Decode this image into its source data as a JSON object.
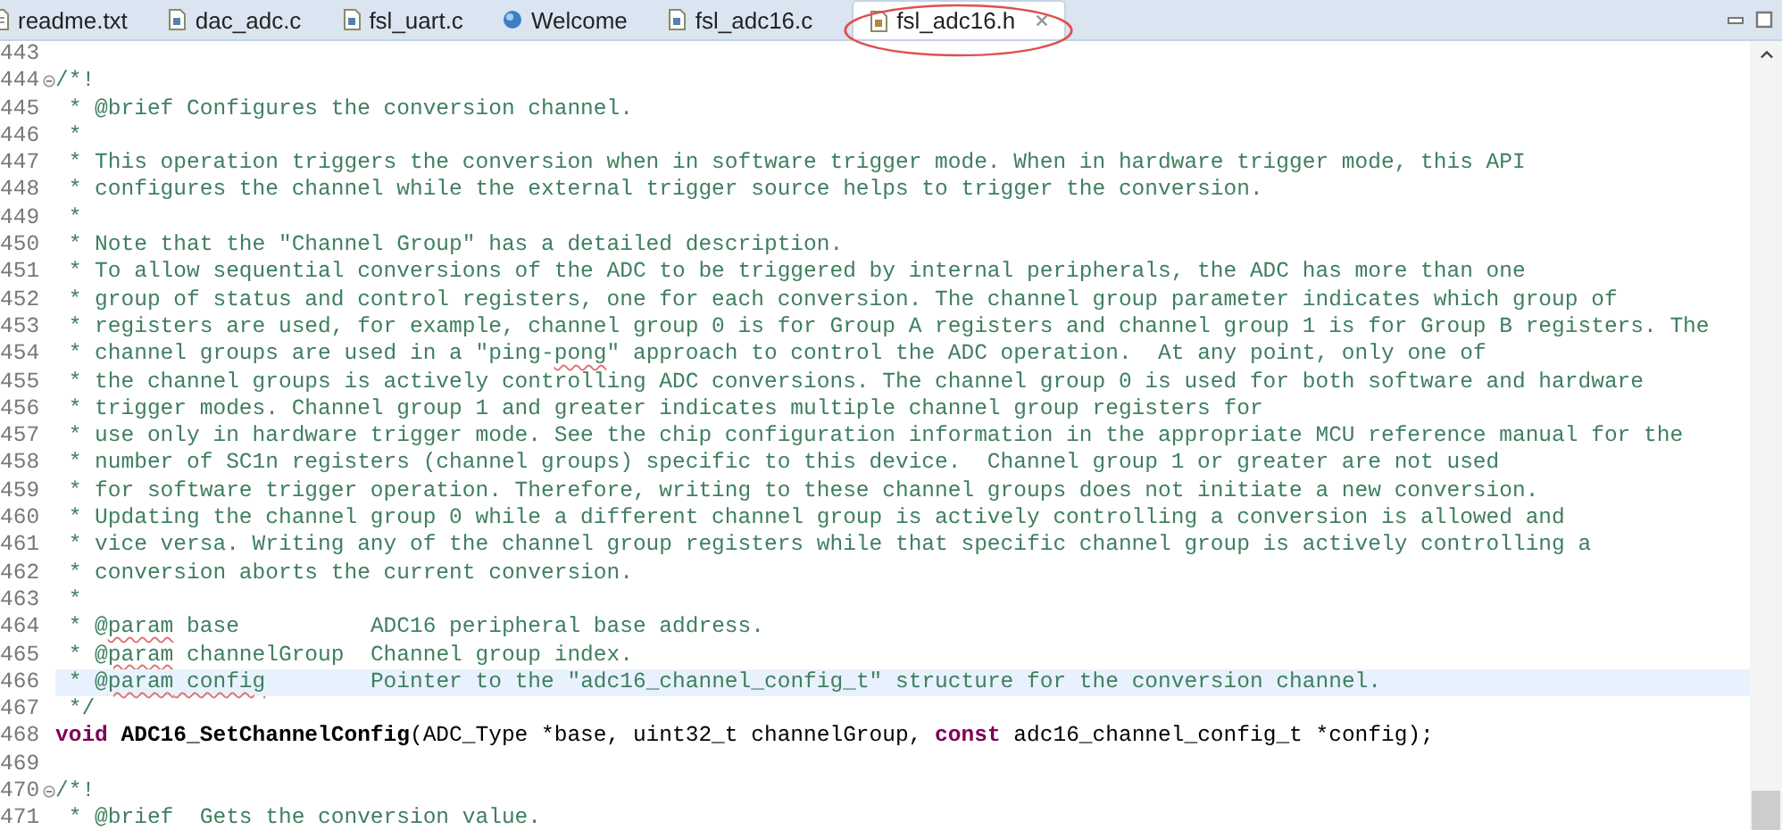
{
  "tabs": [
    {
      "label": "readme.txt",
      "kind": "text",
      "selected": false,
      "marked": false
    },
    {
      "label": "dac_adc.c",
      "kind": "source",
      "selected": false,
      "marked": false
    },
    {
      "label": "fsl_uart.c",
      "kind": "source",
      "selected": false,
      "marked": false
    },
    {
      "label": "Welcome",
      "kind": "web",
      "selected": false,
      "marked": false
    },
    {
      "label": "fsl_adc16.c",
      "kind": "source",
      "selected": false,
      "marked": false
    },
    {
      "label": "fsl_adc16.h",
      "kind": "header",
      "selected": true,
      "marked": true
    }
  ],
  "lines": [
    {
      "number": "443",
      "fold": false,
      "current": false
    },
    {
      "number": "444",
      "fold": true,
      "current": false,
      "tokens": [
        {
          "kind": "comment",
          "text": "/*!"
        }
      ]
    },
    {
      "number": "445",
      "fold": false,
      "current": false,
      "tokens": [
        {
          "kind": "comment",
          "text": " * @brief Configures the conversion channel."
        }
      ]
    },
    {
      "number": "446",
      "fold": false,
      "current": false,
      "tokens": [
        {
          "kind": "comment",
          "text": " *"
        }
      ]
    },
    {
      "number": "447",
      "fold": false,
      "current": false,
      "tokens": [
        {
          "kind": "comment",
          "text": " * This operation triggers the conversion when in software trigger mode. When in hardware trigger mode, this API"
        }
      ]
    },
    {
      "number": "448",
      "fold": false,
      "current": false,
      "tokens": [
        {
          "kind": "comment",
          "text": " * configures the channel while the external trigger source helps to trigger the conversion."
        }
      ]
    },
    {
      "number": "449",
      "fold": false,
      "current": false,
      "tokens": [
        {
          "kind": "comment",
          "text": " *"
        }
      ]
    },
    {
      "number": "450",
      "fold": false,
      "current": false,
      "tokens": [
        {
          "kind": "comment",
          "text": " * Note that the \"Channel Group\" has a detailed description."
        }
      ]
    },
    {
      "number": "451",
      "fold": false,
      "current": false,
      "tokens": [
        {
          "kind": "comment",
          "text": " * To allow sequential conversions of the ADC to be triggered by internal peripherals, the ADC has more than one"
        }
      ]
    },
    {
      "number": "452",
      "fold": false,
      "current": false,
      "tokens": [
        {
          "kind": "comment",
          "text": " * group of status and control registers, one for each conversion. The channel group parameter indicates which group of"
        }
      ]
    },
    {
      "number": "453",
      "fold": false,
      "current": false,
      "tokens": [
        {
          "kind": "comment",
          "text": " * registers are used, for example, channel group 0 is for Group A registers and channel group 1 is for Group B registers. The"
        }
      ]
    },
    {
      "number": "454",
      "fold": false,
      "current": false,
      "tokens": [
        {
          "kind": "comment",
          "text": " * channel groups are used in a \"ping-"
        },
        {
          "kind": "misspelled",
          "text": "pong"
        },
        {
          "kind": "comment",
          "text": "\" approach to control the ADC operation.  At any point, only one of"
        }
      ]
    },
    {
      "number": "455",
      "fold": false,
      "current": false,
      "tokens": [
        {
          "kind": "comment",
          "text": " * the channel groups is actively controlling ADC conversions. The channel group 0 is used for both software and hardware"
        }
      ]
    },
    {
      "number": "456",
      "fold": false,
      "current": false,
      "tokens": [
        {
          "kind": "comment",
          "text": " * trigger modes. Channel group 1 and greater indicates multiple channel group registers for"
        }
      ]
    },
    {
      "number": "457",
      "fold": false,
      "current": false,
      "tokens": [
        {
          "kind": "comment",
          "text": " * use only in hardware trigger mode. See the chip configuration information in the appropriate MCU reference manual for the"
        }
      ]
    },
    {
      "number": "458",
      "fold": false,
      "current": false,
      "tokens": [
        {
          "kind": "comment",
          "text": " * number of SC1n registers (channel groups) specific to this device.  Channel group 1 or greater are not used"
        }
      ]
    },
    {
      "number": "459",
      "fold": false,
      "current": false,
      "tokens": [
        {
          "kind": "comment",
          "text": " * for software trigger operation. Therefore, writing to these channel groups does not initiate a new conversion."
        }
      ]
    },
    {
      "number": "460",
      "fold": false,
      "current": false,
      "tokens": [
        {
          "kind": "comment",
          "text": " * Updating the channel group 0 while a different channel group is actively controlling a conversion is allowed and"
        }
      ]
    },
    {
      "number": "461",
      "fold": false,
      "current": false,
      "tokens": [
        {
          "kind": "comment",
          "text": " * vice versa. Writing any of the channel group registers while that specific channel group is actively controlling a"
        }
      ]
    },
    {
      "number": "462",
      "fold": false,
      "current": false,
      "tokens": [
        {
          "kind": "comment",
          "text": " * conversion aborts the current conversion."
        }
      ]
    },
    {
      "number": "463",
      "fold": false,
      "current": false,
      "tokens": [
        {
          "kind": "comment",
          "text": " *"
        }
      ]
    },
    {
      "number": "464",
      "fold": false,
      "current": false,
      "tokens": [
        {
          "kind": "comment",
          "text": " * @"
        },
        {
          "kind": "misspelled",
          "text": "param"
        },
        {
          "kind": "comment",
          "text": " base          ADC16 peripheral base address."
        }
      ]
    },
    {
      "number": "465",
      "fold": false,
      "current": false,
      "tokens": [
        {
          "kind": "comment",
          "text": " * @"
        },
        {
          "kind": "misspelled",
          "text": "param"
        },
        {
          "kind": "comment",
          "text": " channelGroup  Channel group index."
        }
      ]
    },
    {
      "number": "466",
      "fold": false,
      "current": true,
      "tokens": [
        {
          "kind": "comment",
          "text": " * @"
        },
        {
          "kind": "misspelled",
          "text": "param"
        },
        {
          "kind": "misspelled",
          "text": " config"
        },
        {
          "kind": "comment",
          "text": "        Pointer to the \"adc16_channel_config_t\" structure for the conversion channel."
        }
      ]
    },
    {
      "number": "467",
      "fold": false,
      "current": false,
      "tokens": [
        {
          "kind": "comment",
          "text": " */"
        }
      ]
    },
    {
      "number": "468",
      "fold": false,
      "current": false,
      "tokens": [
        {
          "kind": "keyword",
          "text": "void"
        },
        {
          "kind": "function",
          "text": " ADC16_SetChannelConfig"
        },
        {
          "kind": "plain",
          "text": "(ADC_Type *base, uint32_t channelGroup, "
        },
        {
          "kind": "keyword",
          "text": "const"
        },
        {
          "kind": "plain",
          "text": " adc16_channel_config_t *config);"
        }
      ]
    },
    {
      "number": "469",
      "fold": false,
      "current": false
    },
    {
      "number": "470",
      "fold": true,
      "current": false,
      "tokens": [
        {
          "kind": "comment",
          "text": "/*!"
        }
      ]
    },
    {
      "number": "471",
      "fold": false,
      "current": false,
      "tokens": [
        {
          "kind": "comment",
          "text": " * @brief  Gets the conversion value."
        }
      ]
    }
  ]
}
